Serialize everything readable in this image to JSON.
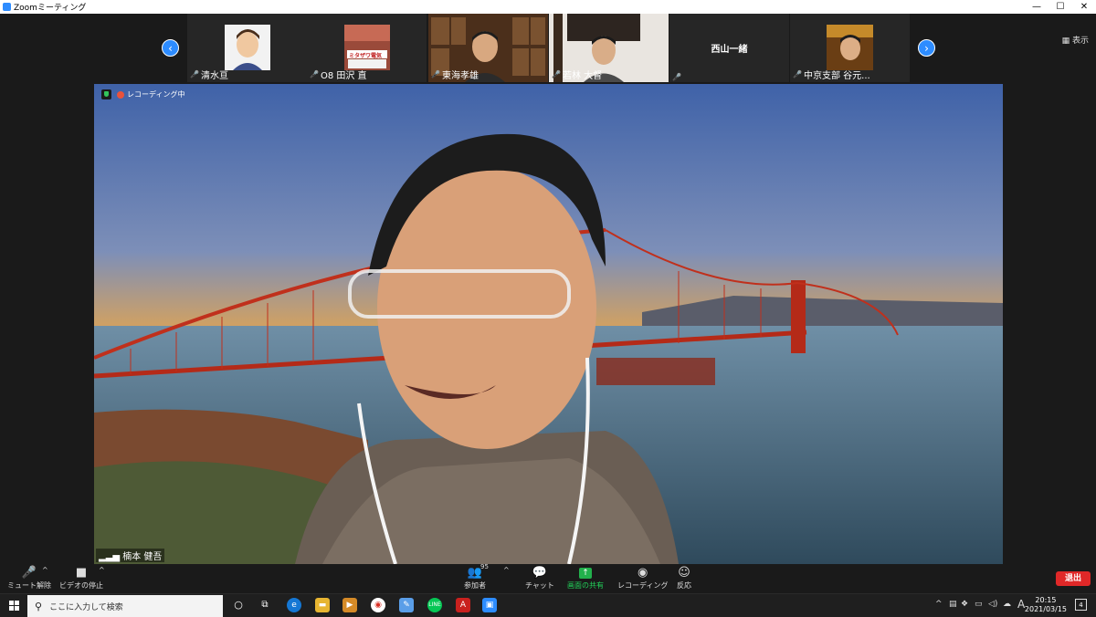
{
  "window": {
    "title": "Zoomミーティング"
  },
  "gallery": {
    "tiles": [
      {
        "name": "清水亘"
      },
      {
        "name": "O8 田沢 直",
        "sign": "ミタザワ電気"
      },
      {
        "name": "東海孝雄"
      },
      {
        "name": "若林 大督"
      },
      {
        "name": "",
        "center": "西山一緒"
      },
      {
        "name": "中京支部 谷元..."
      }
    ],
    "view_label": "表示"
  },
  "main": {
    "recording_label": "レコーディング中",
    "speaker_name": "楠本 健吾"
  },
  "toolbar": {
    "unmute": "ミュート解除",
    "stop_video": "ビデオの停止",
    "participants": "参加者",
    "participants_count": "95",
    "chat": "チャット",
    "share": "画面の共有",
    "record": "レコーディング",
    "reactions": "反応",
    "leave": "退出"
  },
  "taskbar": {
    "search_placeholder": "ここに入力して検索",
    "time": "20:15",
    "date": "2021/03/15",
    "ime": "A",
    "notifications": "4"
  },
  "colors": {
    "accent": "#2d8cff",
    "leave": "#e02828",
    "share": "#22b14c"
  }
}
